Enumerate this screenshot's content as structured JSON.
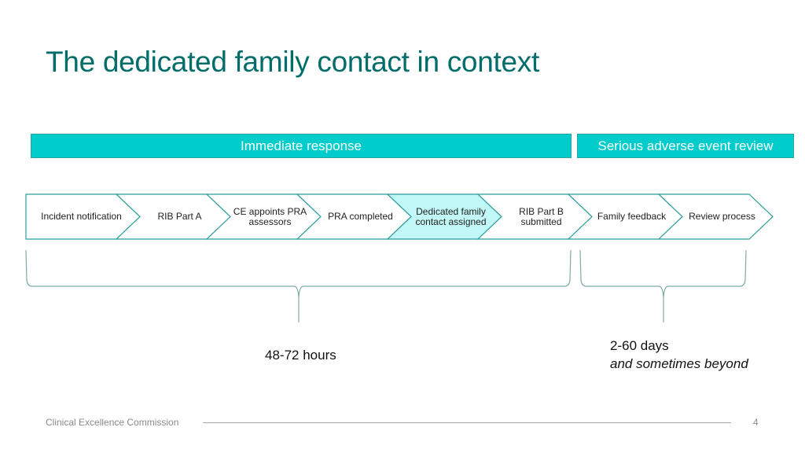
{
  "slide": {
    "title": "The dedicated family contact in context",
    "phases": [
      {
        "label": "Immediate response"
      },
      {
        "label": "Serious adverse event review"
      }
    ],
    "steps": [
      {
        "label": "Incident notification",
        "highlighted": false
      },
      {
        "label": "RIB Part A",
        "highlighted": false
      },
      {
        "label": "CE appoints PRA assessors",
        "highlighted": false
      },
      {
        "label": "PRA completed",
        "highlighted": false
      },
      {
        "label": "Dedicated family contact assigned",
        "highlighted": true
      },
      {
        "label": "RIB Part B submitted",
        "highlighted": false
      },
      {
        "label": "Family feedback",
        "highlighted": false
      },
      {
        "label": "Review process",
        "highlighted": false
      }
    ],
    "durations": {
      "immediate": "48-72 hours",
      "review": "2-60 days",
      "review_note": "and sometimes beyond"
    },
    "colors": {
      "title": "#006d6a",
      "phase_fill": "#00cccc",
      "chevron_stroke": "#2a9d9a",
      "highlight_fill": "#c2f7f7",
      "brace_stroke": "#7faaa5"
    }
  },
  "footer": {
    "organisation": "Clinical Excellence Commission",
    "page_number": "4"
  }
}
